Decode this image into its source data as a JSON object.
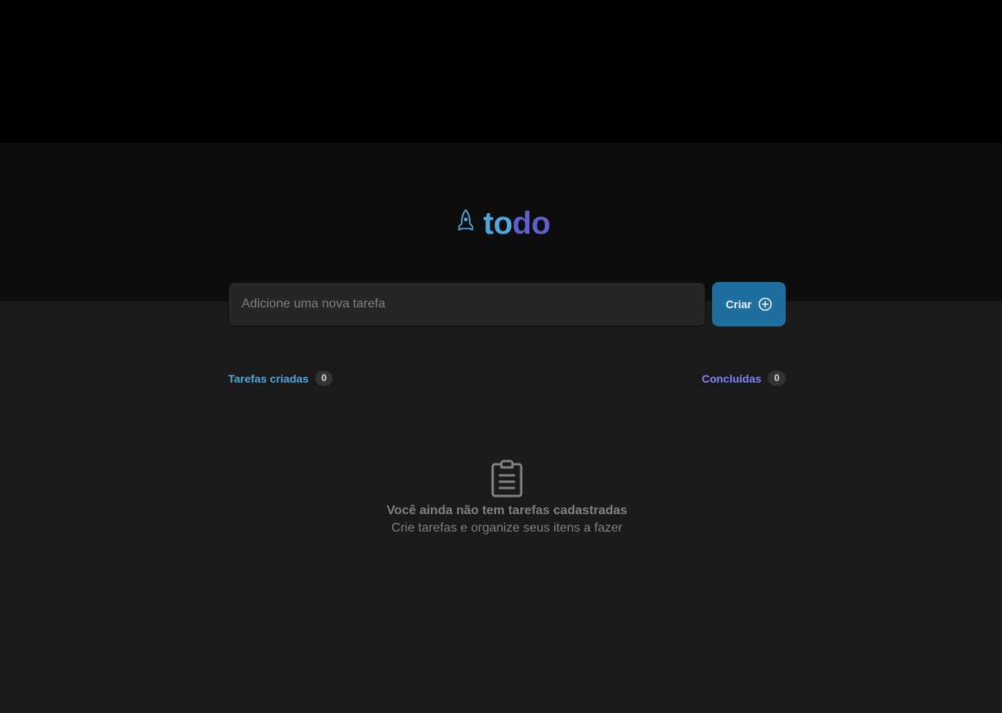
{
  "colors": {
    "brand_blue": "#4ea8de",
    "brand_purple": "#5e60ce",
    "accent_purple": "#8284fa",
    "button_bg": "#1e6f9f"
  },
  "header": {
    "logo_icon": "rocket-icon",
    "logo_part1": "to",
    "logo_part2": "do"
  },
  "new_task": {
    "placeholder": "Adicione uma nova tarefa",
    "value": "",
    "button_label": "Criar",
    "button_icon": "plus-circle-icon"
  },
  "counters": {
    "created_label": "Tarefas criadas",
    "created_count": "0",
    "done_label": "Concluídas",
    "done_count": "0"
  },
  "empty_state": {
    "icon": "clipboard-icon",
    "title": "Você ainda não tem tarefas cadastradas",
    "subtitle": "Crie tarefas e organize seus itens a fazer"
  }
}
